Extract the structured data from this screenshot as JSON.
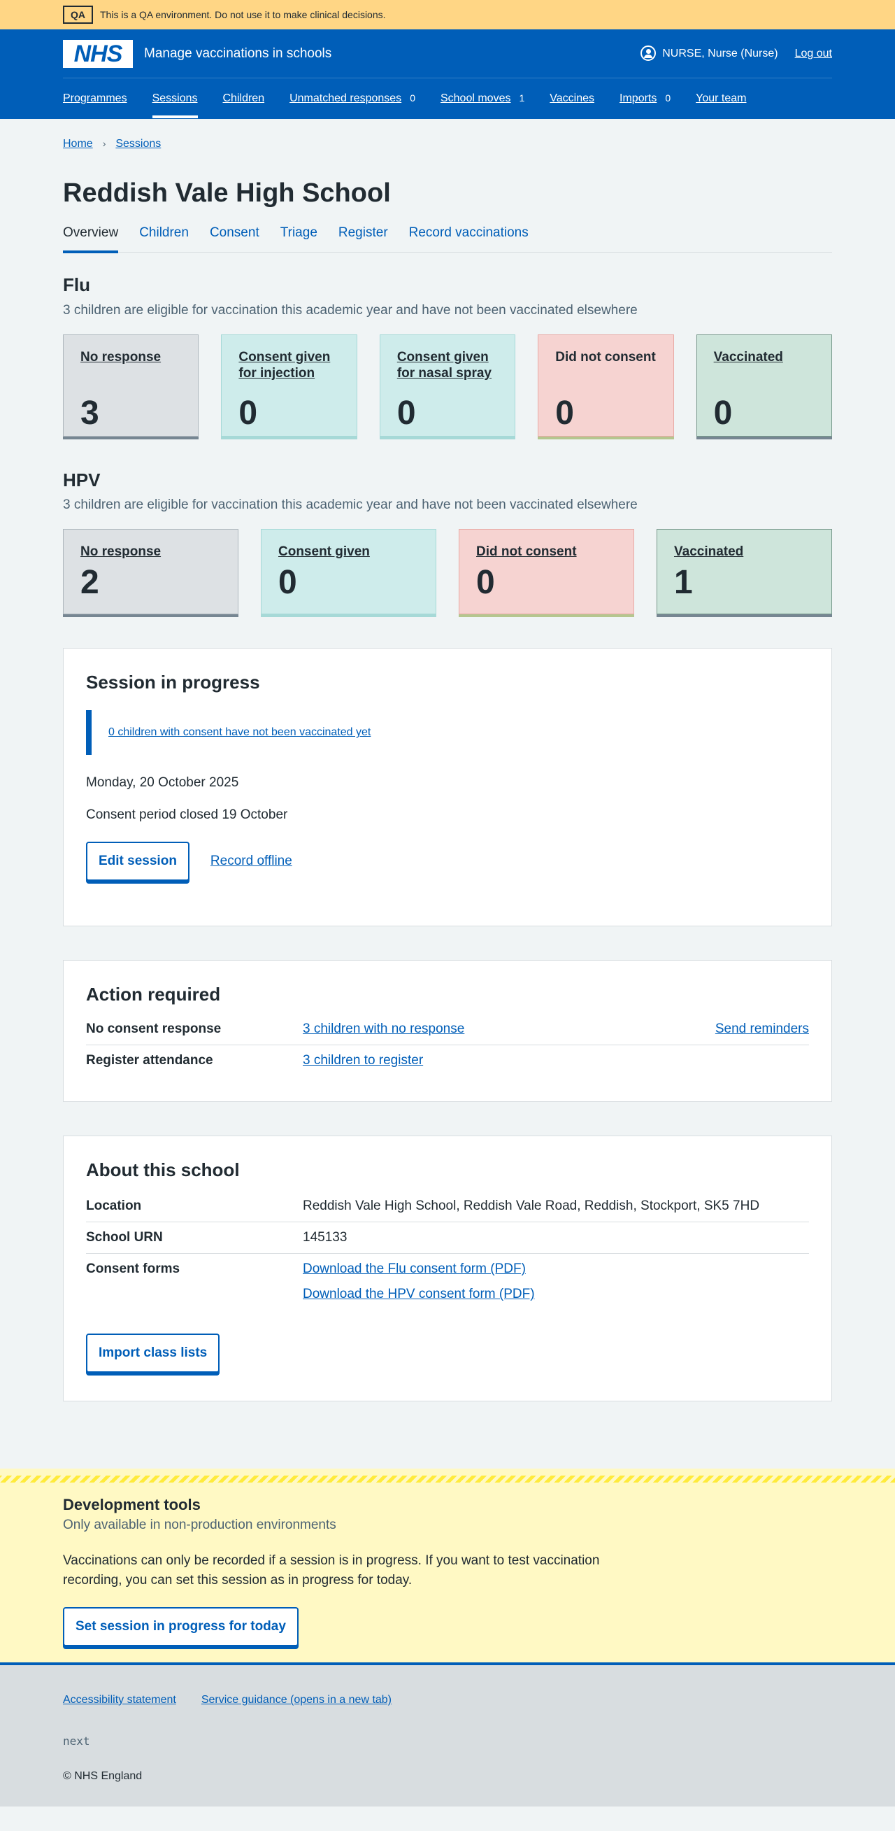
{
  "qa_banner": {
    "tag": "QA",
    "text": "This is a QA environment. Do not use it to make clinical decisions."
  },
  "header": {
    "logo": "NHS",
    "service_name": "Manage vaccinations in schools",
    "user": "NURSE, Nurse (Nurse)",
    "logout": "Log out"
  },
  "nav": {
    "programmes": "Programmes",
    "sessions": "Sessions",
    "children": "Children",
    "unmatched": "Unmatched responses",
    "unmatched_count": "0",
    "school_moves": "School moves",
    "school_moves_count": "1",
    "vaccines": "Vaccines",
    "imports": "Imports",
    "imports_count": "0",
    "your_team": "Your team"
  },
  "breadcrumb": {
    "home": "Home",
    "sessions": "Sessions",
    "separator": "›"
  },
  "title": "Reddish Vale High School",
  "tabs": {
    "overview": "Overview",
    "children": "Children",
    "consent": "Consent",
    "triage": "Triage",
    "register": "Register",
    "record": "Record vaccinations"
  },
  "flu": {
    "heading": "Flu",
    "desc": "3 children are eligible for vaccination this academic year and have not been vaccinated elsewhere",
    "cards": [
      {
        "label": "No response",
        "value": "3"
      },
      {
        "label": "Consent given for injection",
        "value": "0"
      },
      {
        "label": "Consent given for nasal spray",
        "value": "0"
      },
      {
        "label": "Did not consent",
        "value": "0"
      },
      {
        "label": "Vaccinated",
        "value": "0"
      }
    ]
  },
  "hpv": {
    "heading": "HPV",
    "desc": "3 children are eligible for vaccination this academic year and have not been vaccinated elsewhere",
    "cards": [
      {
        "label": "No response",
        "value": "2"
      },
      {
        "label": "Consent given",
        "value": "0"
      },
      {
        "label": "Did not consent",
        "value": "0"
      },
      {
        "label": "Vaccinated",
        "value": "1"
      }
    ]
  },
  "session": {
    "heading": "Session in progress",
    "inset_link": "0 children with consent have not been vaccinated yet",
    "date": "Monday, 20 October 2025",
    "consent_period": "Consent period closed 19 October",
    "edit_button": "Edit session",
    "record_offline": "Record offline"
  },
  "action": {
    "heading": "Action required",
    "rows": [
      {
        "key": "No consent response",
        "value": "3 children with no response",
        "action": "Send reminders"
      },
      {
        "key": "Register attendance",
        "value": "3 children to register"
      }
    ]
  },
  "about": {
    "heading": "About this school",
    "location_key": "Location",
    "location_value": "Reddish Vale High School, Reddish Vale Road, Reddish, Stockport, SK5 7HD",
    "urn_key": "School URN",
    "urn_value": "145133",
    "forms_key": "Consent forms",
    "flu_form": "Download the Flu consent form (PDF)",
    "hpv_form": "Download the HPV consent form (PDF)",
    "import_button": "Import class lists"
  },
  "dev": {
    "heading": "Development tools",
    "sub": "Only available in non-production environments",
    "text": "Vaccinations can only be recorded if a session is in progress. If you want to test vaccination recording, you can set this session as in progress for today.",
    "button": "Set session in progress for today"
  },
  "footer": {
    "accessibility": "Accessibility statement",
    "guidance": "Service guidance (opens in a new tab)",
    "mono": "next",
    "copyright": "© NHS England"
  }
}
